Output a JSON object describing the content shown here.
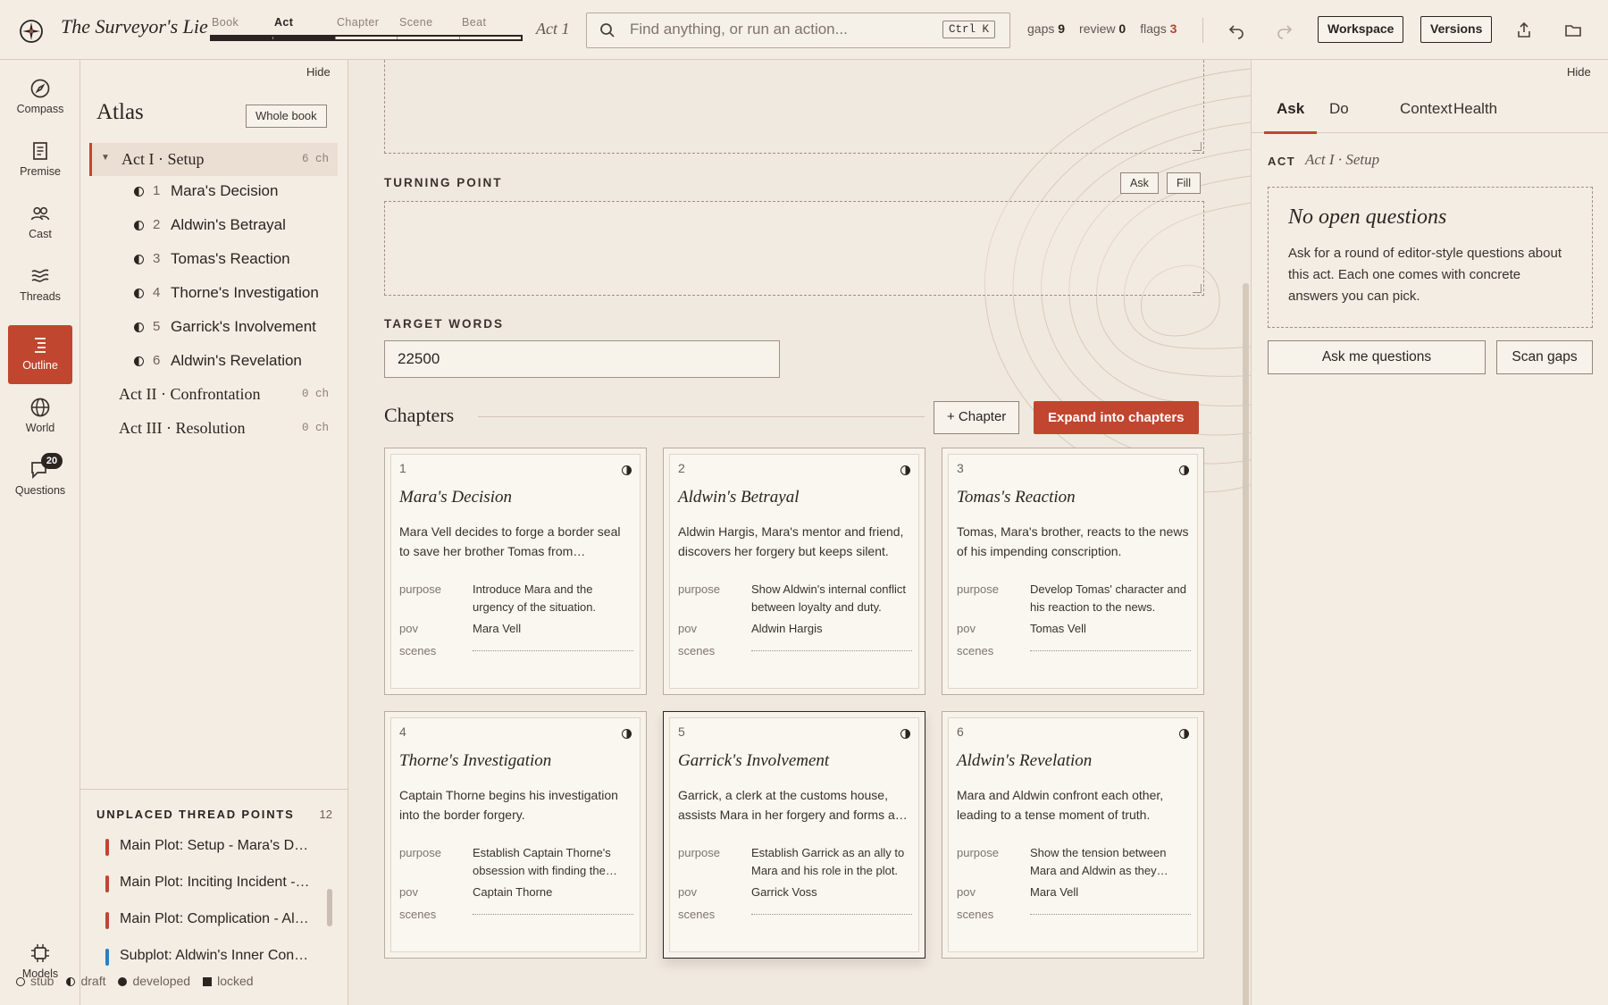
{
  "topbar": {
    "app_title": "The Surveyor's Lie",
    "levels": [
      "Book",
      "Act",
      "Chapter",
      "Scene",
      "Beat"
    ],
    "active_level": "Act",
    "current_act": "Act 1",
    "search_placeholder": "Find anything, or run an action...",
    "search_shortcut": "Ctrl K",
    "stats": {
      "gaps_label": "gaps",
      "gaps": "9",
      "review_label": "review",
      "review": "0",
      "flags_label": "flags",
      "flags": "3"
    },
    "workspace_label": "Workspace",
    "versions_label": "Versions",
    "icons": [
      "undo-icon",
      "redo-icon",
      "export-icon",
      "folder-icon"
    ]
  },
  "rail": {
    "items": [
      {
        "label": "Compass",
        "icon": "compass-icon"
      },
      {
        "label": "Premise",
        "icon": "document-icon"
      },
      {
        "label": "Cast",
        "icon": "people-icon"
      },
      {
        "label": "Threads",
        "icon": "threads-icon"
      },
      {
        "label": "Outline",
        "icon": "outline-icon",
        "active": true
      },
      {
        "label": "World",
        "icon": "globe-icon"
      },
      {
        "label": "Questions",
        "icon": "chat-icon",
        "badge": "20"
      }
    ],
    "models_label": "Models"
  },
  "atlas": {
    "hide_label": "Hide",
    "title": "Atlas",
    "whole_book_label": "Whole book",
    "acts": [
      {
        "name": "Act I · Setup",
        "count": "6 ch",
        "expanded": true,
        "chapters": [
          {
            "num": "1",
            "name": "Mara's Decision"
          },
          {
            "num": "2",
            "name": "Aldwin's Betrayal"
          },
          {
            "num": "3",
            "name": "Tomas's Reaction"
          },
          {
            "num": "4",
            "name": "Thorne's Investigation"
          },
          {
            "num": "5",
            "name": "Garrick's Involvement"
          },
          {
            "num": "6",
            "name": "Aldwin's Revelation"
          }
        ]
      },
      {
        "name": "Act II · Confrontation",
        "count": "0 ch"
      },
      {
        "name": "Act III · Resolution",
        "count": "0 ch"
      }
    ],
    "unplaced": {
      "title": "UNPLACED THREAD POINTS",
      "count": "12",
      "items": [
        {
          "text": "Main Plot: Setup - Mara's Decision",
          "color": "#c1462f"
        },
        {
          "text": "Main Plot: Inciting Incident - Aldwin",
          "color": "#c1462f"
        },
        {
          "text": "Main Plot: Complication - Aldwin",
          "color": "#c1462f"
        },
        {
          "text": "Subplot: Aldwin's Inner Conflict",
          "color": "#2a7fc1"
        }
      ]
    },
    "legend": [
      "stub",
      "draft",
      "developed",
      "locked"
    ]
  },
  "main": {
    "turning_point_label": "TURNING POINT",
    "ask_label": "Ask",
    "fill_label": "Fill",
    "target_words_label": "TARGET WORDS",
    "target_words_value": "22500",
    "chapters_heading": "Chapters",
    "add_chapter_label": "+ Chapter",
    "expand_label": "Expand into chapters",
    "field_keys": {
      "purpose": "purpose",
      "pov": "pov",
      "scenes": "scenes"
    },
    "cards": [
      {
        "num": "1",
        "title": "Mara's Decision",
        "synopsis": "Mara Vell decides to forge a border seal to save her brother Tomas from conscription.",
        "purpose": "Introduce Mara and the urgency of the situation.",
        "pov": "Mara Vell"
      },
      {
        "num": "2",
        "title": "Aldwin's Betrayal",
        "synopsis": "Aldwin Hargis, Mara's mentor and friend, discovers her forgery but keeps silent.",
        "purpose": "Show Aldwin's internal conflict between loyalty and duty.",
        "pov": "Aldwin Hargis"
      },
      {
        "num": "3",
        "title": "Tomas's Reaction",
        "synopsis": "Tomas, Mara's brother, reacts to the news of his impending conscription.",
        "purpose": "Develop Tomas' character and his reaction to the news.",
        "pov": "Tomas Vell"
      },
      {
        "num": "4",
        "title": "Thorne's Investigation",
        "synopsis": "Captain Thorne begins his investigation into the border forgery.",
        "purpose": "Establish Captain Thorne's obsession with finding the forger.",
        "pov": "Captain Thorne"
      },
      {
        "num": "5",
        "title": "Garrick's Involvement",
        "synopsis": "Garrick, a clerk at the customs house, assists Mara in her forgery and forms a bond.",
        "purpose": "Establish Garrick as an ally to Mara and his role in the plot.",
        "pov": "Garrick Voss"
      },
      {
        "num": "6",
        "title": "Aldwin's Revelation",
        "synopsis": "Mara and Aldwin confront each other, leading to a tense moment of truth.",
        "purpose": "Show the tension between Mara and Aldwin as they confront each other.",
        "pov": "Mara Vell"
      }
    ]
  },
  "right": {
    "hide_label": "Hide",
    "tabs": [
      "Ask",
      "Do",
      "Context",
      "Health"
    ],
    "active_tab": "Ask",
    "act_key": "ACT",
    "act_value": "Act I · Setup",
    "empty_title": "No open questions",
    "empty_desc": "Ask for a round of editor-style questions about this act. Each one comes with concrete answers you can pick.",
    "ask_button": "Ask me questions",
    "scan_button": "Scan gaps"
  },
  "colors": {
    "accent": "#c1462f",
    "ink": "#2b2420",
    "paper": "#f0e9df",
    "subplot": "#2a7fc1"
  }
}
